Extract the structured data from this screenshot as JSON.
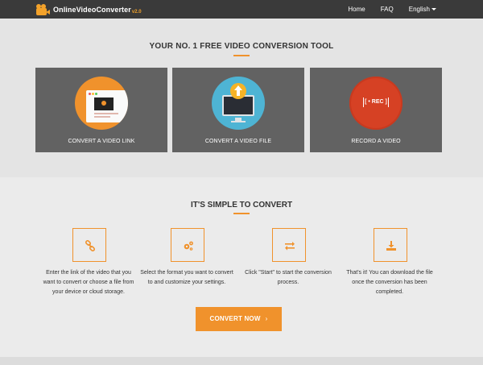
{
  "header": {
    "logo_text": "OnlineVideoConverter",
    "logo_version": "v2.0",
    "nav": [
      "Home",
      "FAQ",
      "English"
    ]
  },
  "hero": {
    "title": "YOUR NO. 1 FREE VIDEO CONVERSION TOOL",
    "cards": [
      {
        "label": "Convert a video link",
        "icon": "browser-video-icon"
      },
      {
        "label": "Convert a video file",
        "icon": "monitor-upload-icon"
      },
      {
        "label": "Record a video",
        "icon": "record-icon",
        "badge": "[ • REC ]"
      }
    ]
  },
  "steps": {
    "title": "IT'S SIMPLE TO CONVERT",
    "items": [
      {
        "icon": "link-icon",
        "text": "Enter the link of the video that you want to convert or choose a file from your device or cloud storage."
      },
      {
        "icon": "gears-icon",
        "text": "Select the format you want to convert to and customize your settings."
      },
      {
        "icon": "swap-arrows-icon",
        "text": "Click \"Start\" to start the conversion process."
      },
      {
        "icon": "download-icon",
        "text": "That's it! You can download the file once the conversion has been completed."
      }
    ]
  },
  "cta": {
    "label": "CONVERT NOW",
    "chevron": "›"
  },
  "colors": {
    "accent": "#f0922c",
    "nav_bg": "#3a3a3a",
    "card_bg": "#626262"
  }
}
